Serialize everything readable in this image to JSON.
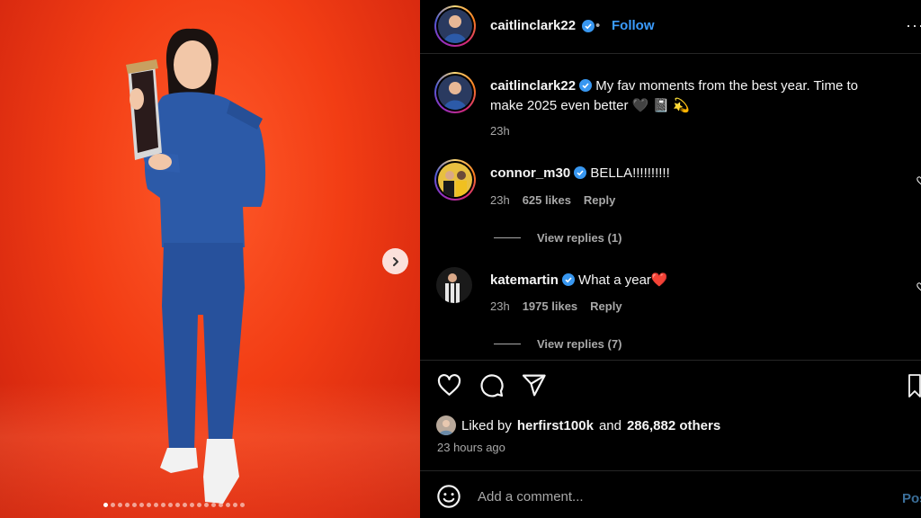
{
  "post": {
    "author": "caitlinclark22",
    "follow_label": "Follow",
    "separator": "•",
    "more_label": "···",
    "caption_text": "My fav moments from the best year. Time to make 2025 even better",
    "caption_emojis": "🖤 📓 💫",
    "caption_time": "23h",
    "image_count": 20,
    "image_index": 1
  },
  "comments": [
    {
      "username": "connor_m30",
      "text": "BELLA!!!!!!!!!!",
      "time": "23h",
      "likes": "625 likes",
      "reply_label": "Reply",
      "view_replies": "View replies (1)"
    },
    {
      "username": "katemartin",
      "text": "What a year",
      "emoji": "❤️",
      "time": "23h",
      "likes": "1975 likes",
      "reply_label": "Reply",
      "view_replies": "View replies (7)"
    }
  ],
  "likes": {
    "prefix": "Liked by",
    "first_user": "herfirst100k",
    "connector": "and",
    "others": "286,882 others"
  },
  "posted_ago": "23 hours ago",
  "add_comment": {
    "placeholder": "Add a comment...",
    "post_label": "Pos"
  },
  "colors": {
    "background": "#000000",
    "photo_bg": "#f23d14",
    "link_blue": "#3b9cff",
    "verified_blue": "#3897f0",
    "muted_text": "#a8a8a8"
  },
  "icons": [
    "heart-icon",
    "comment-icon",
    "share-icon",
    "bookmark-icon",
    "emoji-icon",
    "verified-icon",
    "chevron-right-icon"
  ]
}
